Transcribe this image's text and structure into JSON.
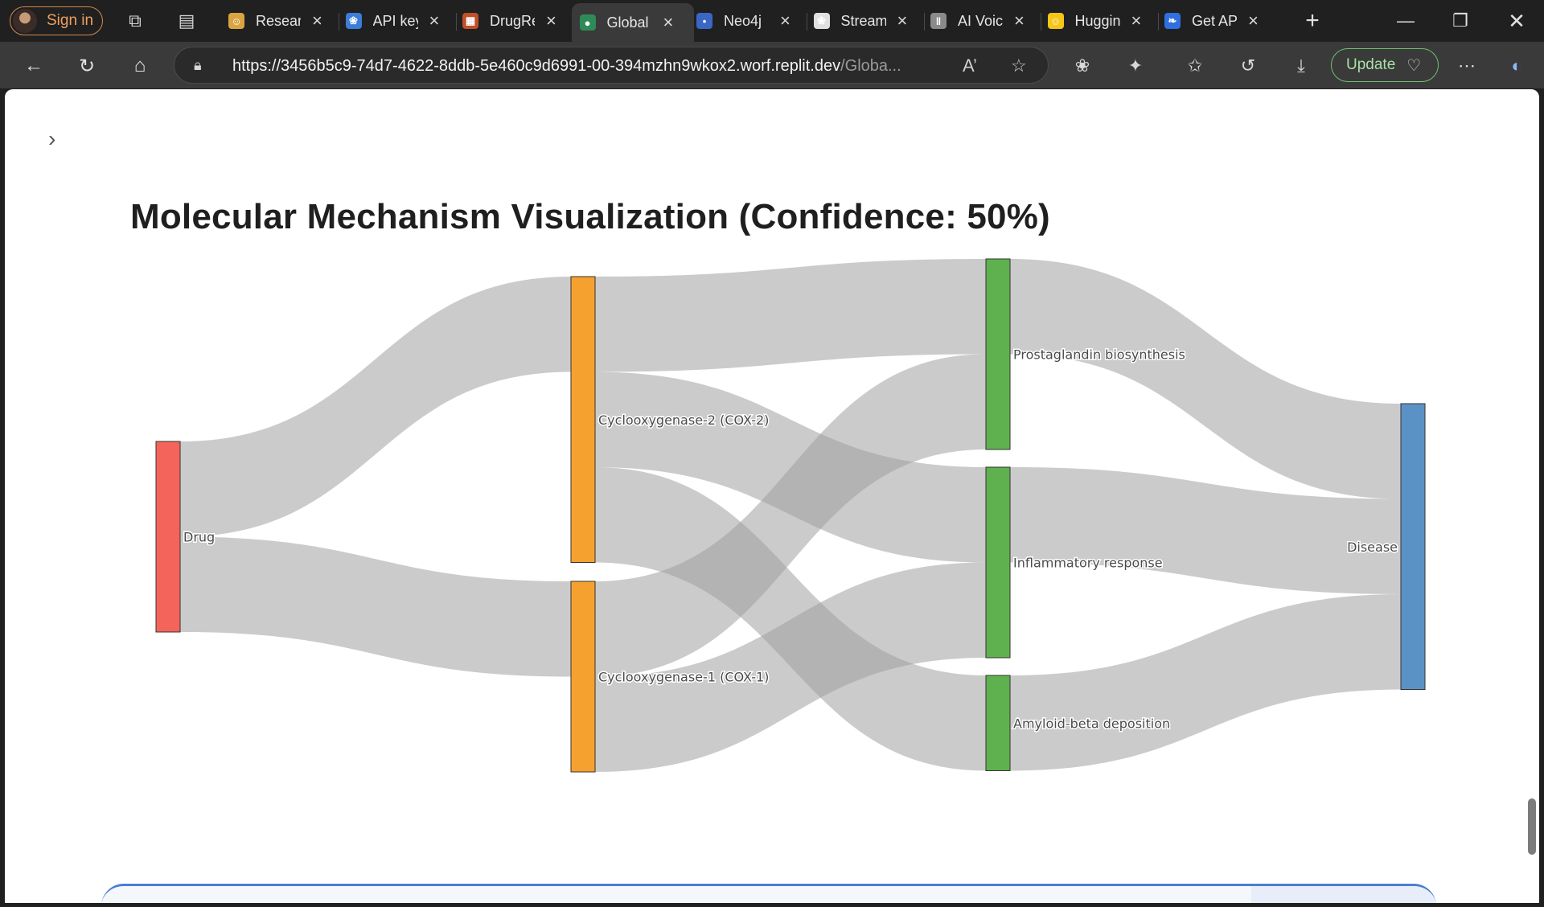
{
  "browser": {
    "signin_label": "Sign in",
    "tabs": [
      {
        "title": "Research",
        "favicon": "hf-icon",
        "color": "#d9a441"
      },
      {
        "title": "API keys",
        "favicon": "openai-icon",
        "color": "#3b7dd8"
      },
      {
        "title": "DrugRe",
        "favicon": "grid-icon",
        "color": "#c0502a"
      },
      {
        "title": "Global",
        "favicon": "globe-icon",
        "color": "#2e8b57",
        "active": true
      },
      {
        "title": "Neo4j",
        "favicon": "neo4j-icon",
        "color": "#3a66c4"
      },
      {
        "title": "Stream",
        "favicon": "openai-icon",
        "color": "#e0e0e0"
      },
      {
        "title": "AI Voic",
        "favicon": "pause-icon",
        "color": "#8a8a8a"
      },
      {
        "title": "Huggin",
        "favicon": "hf-icon",
        "color": "#f5c518"
      },
      {
        "title": "Get AP",
        "favicon": "butterfly-icon",
        "color": "#2f6fe0"
      }
    ],
    "url_host": "https://3456b5c9-74d7-4622-8ddb-5e460c9d6991-00-394mzhn9wkox2.worf.replit.dev",
    "url_path": "/Globa...",
    "update_label": "Update"
  },
  "page": {
    "title": "Molecular Mechanism Visualization (Confidence: 50%)"
  },
  "sankey": {
    "colors": {
      "drug": "#f4645a",
      "target": "#f5a12f",
      "pathway": "#5fb14f",
      "disease": "#5b92c6",
      "link": "rgba(160,160,160,0.55)"
    },
    "nodes": [
      {
        "id": "drug",
        "label": "Drug",
        "group": "drug"
      },
      {
        "id": "cox2",
        "label": "Cyclooxygenase-2 (COX-2)",
        "group": "target"
      },
      {
        "id": "cox1",
        "label": "Cyclooxygenase-1 (COX-1)",
        "group": "target"
      },
      {
        "id": "prost",
        "label": "Prostaglandin biosynthesis",
        "group": "pathway"
      },
      {
        "id": "infl",
        "label": "Inflammatory response",
        "group": "pathway"
      },
      {
        "id": "amyl",
        "label": "Amyloid-beta deposition",
        "group": "pathway"
      },
      {
        "id": "dis",
        "label": "Disease",
        "group": "disease"
      }
    ],
    "links": [
      {
        "source": "drug",
        "target": "cox2",
        "value": 1
      },
      {
        "source": "drug",
        "target": "cox1",
        "value": 1
      },
      {
        "source": "cox2",
        "target": "prost",
        "value": 1
      },
      {
        "source": "cox2",
        "target": "infl",
        "value": 1
      },
      {
        "source": "cox2",
        "target": "amyl",
        "value": 1
      },
      {
        "source": "cox1",
        "target": "prost",
        "value": 1
      },
      {
        "source": "cox1",
        "target": "infl",
        "value": 1
      },
      {
        "source": "prost",
        "target": "dis",
        "value": 1
      },
      {
        "source": "infl",
        "target": "dis",
        "value": 1
      },
      {
        "source": "amyl",
        "target": "dis",
        "value": 1
      }
    ]
  }
}
